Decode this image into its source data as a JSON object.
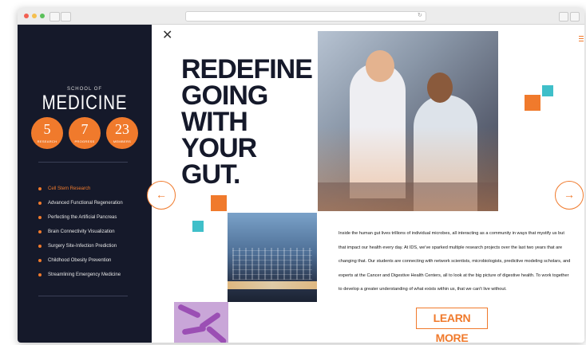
{
  "browser": {
    "window_dots": [
      "#f26052",
      "#f5bf4f",
      "#5ac05a"
    ]
  },
  "sidebar": {
    "school_label": "SCHOOL OF",
    "school_name": "MEDICINE",
    "stats": [
      {
        "number": "5",
        "label": "RESEARCH"
      },
      {
        "number": "7",
        "label": "PROGRESS"
      },
      {
        "number": "23",
        "label": "MEMBERS"
      }
    ],
    "menu": [
      {
        "label": "Cell Stem Research",
        "active": true
      },
      {
        "label": "Advanced Functional Regeneration",
        "active": false
      },
      {
        "label": "Perfecting the Artificial Pancreas",
        "active": false
      },
      {
        "label": "Brain Connectivity Visualization",
        "active": false
      },
      {
        "label": "Surgery Site-Infection Prediction",
        "active": false
      },
      {
        "label": "Childhood Obesity Prevention",
        "active": false
      },
      {
        "label": "Streamlining Emergency Medicine",
        "active": false
      }
    ]
  },
  "main": {
    "headline": "REDEFINE GOING WITH YOUR GUT.",
    "body": "Inside the human gut lives trillions of individual microbes, all interacting as a community in ways that mystify us but that impact our health every day. At IDS, we've sparked multiple research projects over the last two years that are changing that. Our students are connecting with network scientists, microbiologists, predictive modeling scholars, and experts at the Cancer and Digestive Health Centers, all to look at the big picture of digestive health. To work together to develop a greater understanding of what exists within us, that we can't live without.",
    "cta": "LEARN MORE"
  },
  "colors": {
    "accent": "#f07a2c",
    "teal": "#3fbfc9",
    "sidebar_bg": "#15192a"
  },
  "icons": {
    "close": "close-icon",
    "prev": "arrow-left-icon",
    "next": "arrow-right-icon",
    "menu": "hamburger-icon"
  }
}
